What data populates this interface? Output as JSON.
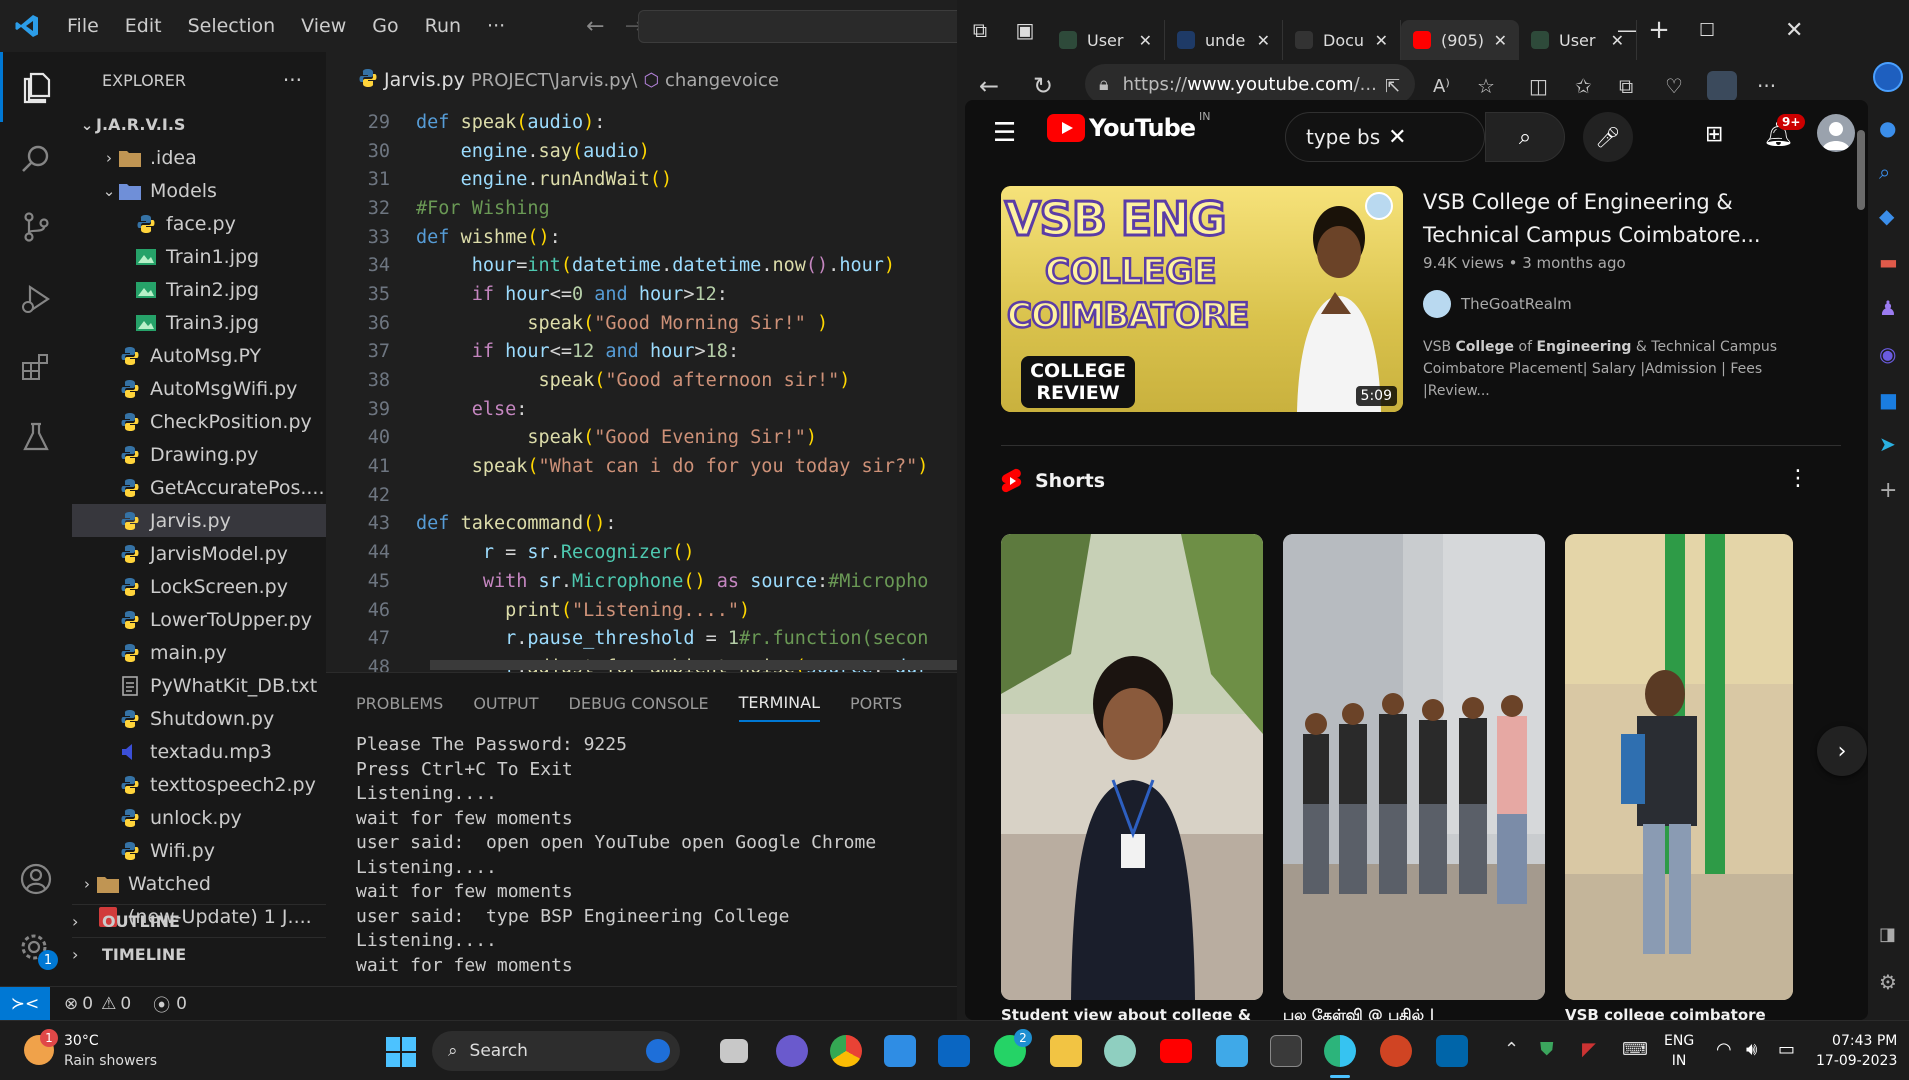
{
  "vscode": {
    "menu": [
      "File",
      "Edit",
      "Selection",
      "View",
      "Go",
      "Run",
      "···"
    ],
    "explorer_title": "EXPLORER",
    "explorer_more": "···",
    "project": "J.A.R.V.I.S",
    "tree": [
      {
        "label": ".idea",
        "type": "folder",
        "depth": 1,
        "chev": "›"
      },
      {
        "label": "Models",
        "type": "folder-open",
        "depth": 1,
        "chev": "⌄"
      },
      {
        "label": "face.py",
        "type": "py",
        "depth": 2
      },
      {
        "label": "Train1.jpg",
        "type": "img",
        "depth": 2
      },
      {
        "label": "Train2.jpg",
        "type": "img",
        "depth": 2
      },
      {
        "label": "Train3.jpg",
        "type": "img",
        "depth": 2
      },
      {
        "label": "AutoMsg.PY",
        "type": "py",
        "depth": 1
      },
      {
        "label": "AutoMsgWifi.py",
        "type": "py",
        "depth": 1
      },
      {
        "label": "CheckPosition.py",
        "type": "py",
        "depth": 1
      },
      {
        "label": "Drawing.py",
        "type": "py",
        "depth": 1
      },
      {
        "label": "GetAccuratePos....",
        "type": "py",
        "depth": 1
      },
      {
        "label": "Jarvis.py",
        "type": "py",
        "depth": 1,
        "selected": true
      },
      {
        "label": "JarvisModel.py",
        "type": "py",
        "depth": 1
      },
      {
        "label": "LockScreen.py",
        "type": "py",
        "depth": 1
      },
      {
        "label": "LowerToUpper.py",
        "type": "py",
        "depth": 1
      },
      {
        "label": "main.py",
        "type": "py",
        "depth": 1
      },
      {
        "label": "PyWhatKit_DB.txt",
        "type": "txt",
        "depth": 1
      },
      {
        "label": "Shutdown.py",
        "type": "py",
        "depth": 1
      },
      {
        "label": "textadu.mp3",
        "type": "mp3",
        "depth": 1
      },
      {
        "label": "texttospeech2.py",
        "type": "py",
        "depth": 1
      },
      {
        "label": "unlock.py",
        "type": "py",
        "depth": 1
      },
      {
        "label": "Wifi.py",
        "type": "py",
        "depth": 1
      },
      {
        "label": "Watched",
        "type": "folder",
        "depth": 0,
        "chev": "›"
      },
      {
        "label": "(new-Update) 1 J....",
        "type": "video",
        "depth": 0
      }
    ],
    "outline": "OUTLINE",
    "timeline": "TIMELINE",
    "breadcrumb": {
      "file": "Jarvis.py",
      "path": "PROJECT\\Jarvis.py\\",
      "symbol": "changevoice"
    },
    "panel_tabs": [
      "PROBLEMS",
      "OUTPUT",
      "DEBUG CONSOLE",
      "TERMINAL",
      "PORTS"
    ],
    "active_panel_tab": "TERMINAL",
    "terminal_lines": [
      "Please The Password: 9225",
      "Press Ctrl+C To Exit",
      "Listening....",
      "wait for few moments",
      "user said:  open open YouTube open Google Chrome",
      "Listening....",
      "wait for few moments",
      "user said:  type BSP Engineering College",
      "Listening....",
      "wait for few moments"
    ],
    "status": {
      "errors": "0",
      "warnings": "0",
      "ports": "0"
    },
    "accounts_badge": "1"
  },
  "edge": {
    "tabs": [
      {
        "label": "User",
        "active": false
      },
      {
        "label": "unde",
        "active": false
      },
      {
        "label": "Docu",
        "active": false
      },
      {
        "label": "(905)",
        "active": true
      },
      {
        "label": "User",
        "active": false
      }
    ],
    "url_prefix": "https://",
    "url_domain": "www.youtube.com",
    "url_rest": "/...",
    "youtube": {
      "logo": "YouTube",
      "region": "IN",
      "search_value": "type bs",
      "notif_badge": "9+",
      "video": {
        "thumb_line1": "VSB ENG",
        "thumb_line2": "COLLEGE",
        "thumb_line3": "COIMBATORE",
        "thumb_badge_1": "COLLEGE",
        "thumb_badge_2": "REVIEW",
        "duration": "5:09",
        "title": "VSB College of Engineering & Technical Campus Coimbatore...",
        "views": "9.4K views",
        "age": "3 months ago",
        "channel": "TheGoatRealm",
        "desc_line1_a": "VSB ",
        "desc_line1_b": "College",
        "desc_line1_c": " of ",
        "desc_line1_d": "Engineering",
        "desc_line1_e": " & Technical Campus",
        "desc_line2": "Coimbatore Placement| Salary |Admission | Fees |Review..."
      },
      "shorts_title": "Shorts",
      "shorts": [
        {
          "title": "Student view about college &"
        },
        {
          "title": "பல கேள்வி @ பதில் |"
        },
        {
          "title": "VSB college coimbatore"
        }
      ]
    }
  },
  "taskbar": {
    "weather_temp": "30°C",
    "weather_desc": "Rain showers",
    "weather_badge": "1",
    "search_label": "Search",
    "whatsapp_badge": "2",
    "lang_1": "ENG",
    "lang_2": "IN",
    "time": "07:43 PM",
    "date": "17-09-2023"
  },
  "colors": {
    "vscode_accent": "#0078d4",
    "youtube_red": "#ff0000",
    "thumb_yellow": "#f5d21c"
  }
}
